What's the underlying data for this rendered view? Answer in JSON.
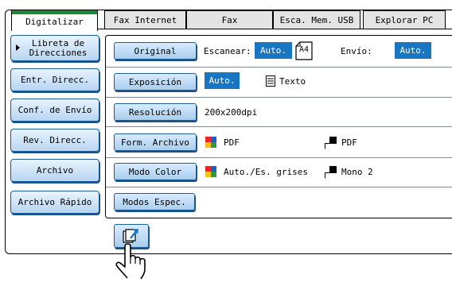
{
  "tabs": [
    {
      "label": "Digitalizar",
      "active": true
    },
    {
      "label": "Fax Internet",
      "active": false
    },
    {
      "label": "Fax",
      "active": false
    },
    {
      "label": "Esca. Mem. USB",
      "active": false
    },
    {
      "label": "Explorar PC",
      "active": false
    }
  ],
  "sidebar": [
    {
      "label": "Libreta de Direcciones"
    },
    {
      "label": "Entr. Direcc."
    },
    {
      "label": "Conf. de Envío"
    },
    {
      "label": "Rev. Direcc."
    },
    {
      "label": "Archivo"
    },
    {
      "label": "Archivo Rápido"
    }
  ],
  "settings": {
    "original": {
      "button": "Original",
      "scan_label": "Escanear:",
      "scan_value": "Auto.",
      "paper": "A4",
      "send_label": "Envío:",
      "send_value": "Auto."
    },
    "exposure": {
      "button": "Exposición",
      "value": "Auto.",
      "mode": "Texto"
    },
    "resolution": {
      "button": "Resolución",
      "value": "200x200dpi"
    },
    "file_format": {
      "button": "Form. Archivo",
      "color_value": "PDF",
      "mono_value": "PDF"
    },
    "color_mode": {
      "button": "Modo Color",
      "color_value": "Auto./Es. grises",
      "mono_value": "Mono 2"
    },
    "special_modes": {
      "button": "Modos Espec."
    }
  },
  "colors": {
    "active_tab": "#1a8a3e",
    "selected": "#1976c2",
    "button_border": "#1a5c9a"
  }
}
